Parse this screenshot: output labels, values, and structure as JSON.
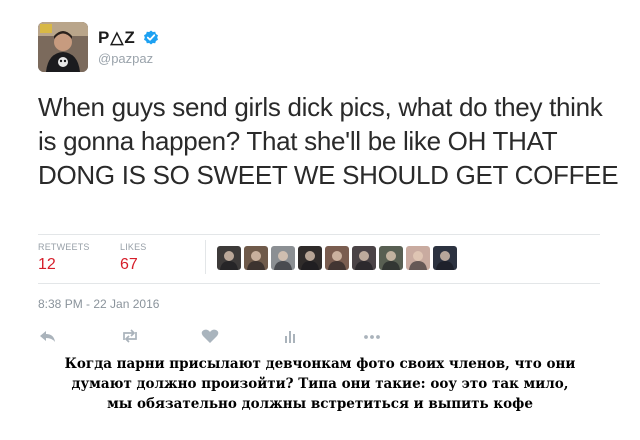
{
  "tweet": {
    "author": {
      "display_name": "P△Z",
      "handle": "@pazpaz",
      "verified": true,
      "avatar_icon": "user-avatar-photo"
    },
    "text": "When guys send girls dick pics, what do they think is gonna happen? That she'll be like OH THAT DONG IS SO SWEET WE SHOULD GET COFFEE",
    "stats": {
      "retweets_label": "RETWEETS",
      "retweets": "12",
      "likes_label": "LIKES",
      "likes": "67"
    },
    "liker_avatars": [
      {
        "name": "liker-avatar-1",
        "color": "#3d3a39"
      },
      {
        "name": "liker-avatar-2",
        "color": "#6f5a4a"
      },
      {
        "name": "liker-avatar-3",
        "color": "#8b8f93"
      },
      {
        "name": "liker-avatar-4",
        "color": "#2f2b2a"
      },
      {
        "name": "liker-avatar-5",
        "color": "#7a5d50"
      },
      {
        "name": "liker-avatar-6",
        "color": "#4a4346"
      },
      {
        "name": "liker-avatar-7",
        "color": "#585f52"
      },
      {
        "name": "liker-avatar-8",
        "color": "#c9aba0"
      },
      {
        "name": "liker-avatar-9",
        "color": "#2c3240"
      }
    ],
    "timestamp": "8:38 PM - 22 Jan 2016",
    "actions": [
      "reply-icon",
      "retweet-icon",
      "like-icon",
      "analytics-icon",
      "more-icon"
    ]
  },
  "caption": {
    "line1": "Когда парни присылают девчонкам фото своих членов, что они",
    "line2": "думают должно произойти? Типа они такие: ооу это так мило,",
    "line3": "мы обязательно должны встретиться и выпить кофе"
  },
  "colors": {
    "accent_red": "#d61e2a",
    "verified_blue": "#1da1f2",
    "muted_gray": "#9aa3ab",
    "like_heart": "#a9b4bd"
  }
}
